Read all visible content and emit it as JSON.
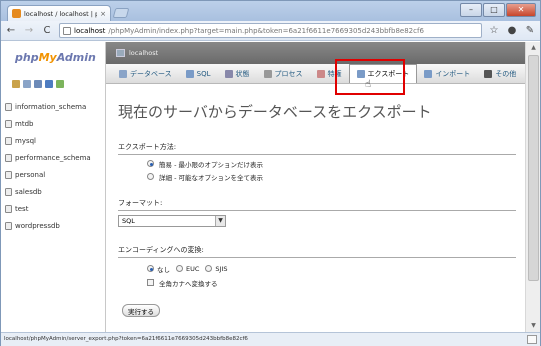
{
  "browser": {
    "tab_title": "localhost / localhost | phpM",
    "tab_close": "×",
    "window_controls": {
      "minimize": "–",
      "maximize": "□",
      "close": "✕"
    },
    "back": "←",
    "forward": "→",
    "reload": "C",
    "url_host": "localhost",
    "url_path": "/phpMyAdmin/index.php?target=main.php&token=6a21f6611e7669305d243bbfb8e82cf6",
    "status_text": "localhost/phpMyAdmin/server_export.php?token=6a21f6611e7669305d243bbfb8e82cf6"
  },
  "sidebar": {
    "logo": {
      "php": "php",
      "my": "My",
      "admin": "Admin"
    },
    "databases": [
      "information_schema",
      "mtdb",
      "mysql",
      "performance_schema",
      "personal",
      "salesdb",
      "test",
      "wordpressdb"
    ]
  },
  "main": {
    "server_label": "localhost",
    "menu": [
      {
        "label": "データベース",
        "color": "#8aa4c8"
      },
      {
        "label": "SQL",
        "color": "#7a9bc7"
      },
      {
        "label": "状態",
        "color": "#88a"
      },
      {
        "label": "プロセス",
        "color": "#999"
      },
      {
        "label": "特権",
        "color": "#c88"
      },
      {
        "label": "エクスポート",
        "color": "#7a9bc7"
      },
      {
        "label": "インポート",
        "color": "#7a9bc7"
      },
      {
        "label": "その他",
        "color": "#555"
      }
    ],
    "title": "現在のサーバからデータベースをエクスポート",
    "export_method": {
      "label": "エクスポート方法:",
      "options": [
        "簡易 - 最小限のオプションだけ表示",
        "詳細 - 可能なオプションを全て表示"
      ],
      "selected": 0
    },
    "format": {
      "label": "フォーマット:",
      "value": "SQL",
      "arrow": "▼"
    },
    "encoding": {
      "label": "エンコーディングへの変換:",
      "options": [
        "なし",
        "EUC",
        "SJIS"
      ],
      "selected": 0,
      "checkbox_label": "全角カナへ変換する"
    },
    "go_button": "実行する"
  },
  "colors": {
    "highlight": "#e00000",
    "link": "#235a81"
  }
}
